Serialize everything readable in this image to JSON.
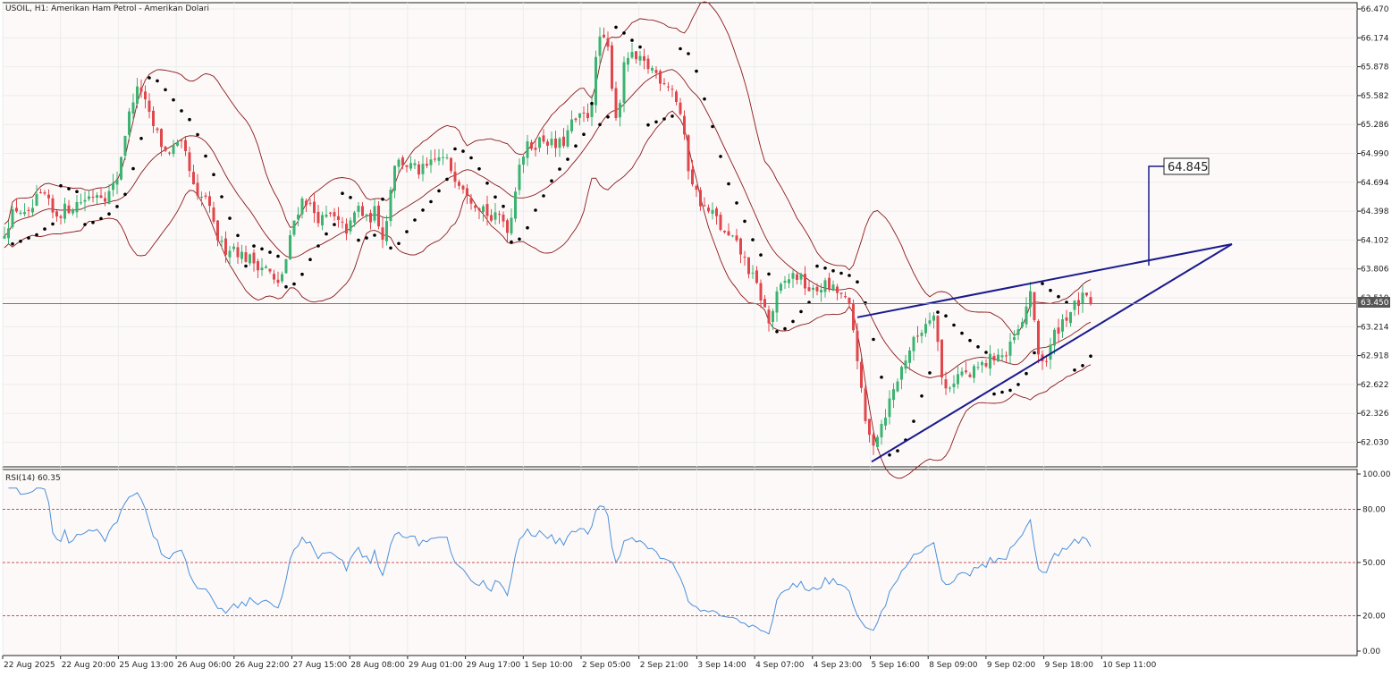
{
  "header": {
    "title": "USOIL, H1:  Amerikan Ham Petrol - Amerikan Dolari"
  },
  "colors": {
    "background": "#fdf9f9",
    "bull": "#3cb371",
    "bear": "#e0474c",
    "bands": "#8b1a1a",
    "sar": "#000000",
    "trendline": "#1a1a8c",
    "rsi_line": "#4a90d9",
    "rsi_level": "#b22222",
    "price_line": "#555555"
  },
  "chart_data": [
    {
      "type": "candlestick",
      "title": "USOIL, H1:  Amerikan Ham Petrol - Amerikan Dolari",
      "indicators": [
        "Bollinger Bands",
        "Parabolic SAR"
      ],
      "ylim": [
        61.78,
        66.49
      ],
      "y_ticks": [
        "66.470",
        "66.174",
        "65.878",
        "65.582",
        "65.286",
        "64.990",
        "64.694",
        "64.398",
        "64.102",
        "63.806",
        "63.510",
        "63.214",
        "62.918",
        "62.622",
        "62.326",
        "62.030"
      ],
      "x_ticks": [
        "22 Aug 2025",
        "22 Aug 20:00",
        "25 Aug 13:00",
        "26 Aug 06:00",
        "26 Aug 22:00",
        "27 Aug 15:00",
        "28 Aug 08:00",
        "29 Aug 01:00",
        "29 Aug 17:00",
        "1 Sep 10:00",
        "2 Sep 05:00",
        "2 Sep 21:00",
        "3 Sep 14:00",
        "4 Sep 07:00",
        "4 Sep 23:00",
        "5 Sep 16:00",
        "8 Sep 09:00",
        "9 Sep 02:00",
        "9 Sep 18:00",
        "10 Sep 11:00"
      ],
      "current_price": "63.450",
      "annotation": "64.845",
      "close_path": [
        [
          0,
          64.1
        ],
        [
          10,
          64.3
        ],
        [
          20,
          64.45
        ],
        [
          30,
          64.3
        ],
        [
          40,
          64.5
        ],
        [
          50,
          64.55
        ],
        [
          60,
          64.35
        ],
        [
          70,
          64.4
        ],
        [
          80,
          64.45
        ],
        [
          90,
          64.5
        ],
        [
          100,
          64.55
        ],
        [
          110,
          64.6
        ],
        [
          120,
          64.55
        ],
        [
          130,
          64.7
        ],
        [
          140,
          65.2
        ],
        [
          150,
          65.6
        ],
        [
          158,
          65.65
        ],
        [
          165,
          65.4
        ],
        [
          175,
          65.2
        ],
        [
          185,
          65.0
        ],
        [
          195,
          65.05
        ],
        [
          205,
          65.05
        ],
        [
          212,
          64.8
        ],
        [
          220,
          64.5
        ],
        [
          230,
          64.55
        ],
        [
          240,
          64.2
        ],
        [
          250,
          64.0
        ],
        [
          260,
          64.05
        ],
        [
          270,
          63.95
        ],
        [
          280,
          63.9
        ],
        [
          290,
          63.85
        ],
        [
          300,
          63.8
        ],
        [
          310,
          63.6
        ],
        [
          320,
          63.9
        ],
        [
          330,
          64.35
        ],
        [
          340,
          64.55
        ],
        [
          350,
          64.4
        ],
        [
          360,
          64.3
        ],
        [
          370,
          64.35
        ],
        [
          380,
          64.25
        ],
        [
          390,
          64.2
        ],
        [
          400,
          64.45
        ],
        [
          410,
          64.3
        ],
        [
          420,
          64.4
        ],
        [
          430,
          64.1
        ],
        [
          440,
          64.9
        ],
        [
          450,
          64.9
        ],
        [
          460,
          64.85
        ],
        [
          470,
          64.8
        ],
        [
          480,
          64.85
        ],
        [
          490,
          64.95
        ],
        [
          500,
          64.9
        ],
        [
          510,
          64.75
        ],
        [
          520,
          64.65
        ],
        [
          530,
          64.5
        ],
        [
          540,
          64.45
        ],
        [
          550,
          64.3
        ],
        [
          560,
          64.35
        ],
        [
          570,
          64.2
        ],
        [
          580,
          64.9
        ],
        [
          590,
          65.05
        ],
        [
          600,
          65.1
        ],
        [
          610,
          65.15
        ],
        [
          620,
          65.05
        ],
        [
          630,
          65.1
        ],
        [
          640,
          65.3
        ],
        [
          650,
          65.35
        ],
        [
          660,
          65.4
        ],
        [
          670,
          66.2
        ],
        [
          680,
          66.05
        ],
        [
          690,
          65.3
        ],
        [
          700,
          66.0
        ],
        [
          710,
          65.95
        ],
        [
          720,
          65.9
        ],
        [
          730,
          65.85
        ],
        [
          740,
          65.75
        ],
        [
          750,
          65.7
        ],
        [
          760,
          65.45
        ],
        [
          770,
          64.85
        ],
        [
          780,
          64.55
        ],
        [
          790,
          64.4
        ],
        [
          800,
          64.35
        ],
        [
          810,
          64.15
        ],
        [
          820,
          64.1
        ],
        [
          830,
          63.95
        ],
        [
          840,
          63.75
        ],
        [
          850,
          63.55
        ],
        [
          860,
          63.25
        ],
        [
          870,
          63.55
        ],
        [
          880,
          63.7
        ],
        [
          890,
          63.75
        ],
        [
          900,
          63.65
        ],
        [
          910,
          63.55
        ],
        [
          920,
          63.65
        ],
        [
          930,
          63.6
        ],
        [
          940,
          63.55
        ],
        [
          950,
          63.4
        ],
        [
          958,
          63.0
        ],
        [
          966,
          62.3
        ],
        [
          975,
          62.0
        ],
        [
          985,
          62.2
        ],
        [
          995,
          62.45
        ],
        [
          1005,
          62.7
        ],
        [
          1015,
          62.95
        ],
        [
          1025,
          63.1
        ],
        [
          1035,
          63.25
        ],
        [
          1045,
          63.4
        ],
        [
          1055,
          62.55
        ],
        [
          1065,
          62.65
        ],
        [
          1075,
          62.75
        ],
        [
          1085,
          62.7
        ],
        [
          1095,
          62.8
        ],
        [
          1105,
          62.85
        ],
        [
          1115,
          62.95
        ],
        [
          1125,
          62.9
        ],
        [
          1135,
          63.1
        ],
        [
          1145,
          63.25
        ],
        [
          1152,
          63.65
        ],
        [
          1160,
          62.95
        ],
        [
          1170,
          62.85
        ],
        [
          1180,
          63.15
        ],
        [
          1190,
          63.3
        ],
        [
          1200,
          63.4
        ],
        [
          1210,
          63.5
        ],
        [
          1220,
          63.45
        ]
      ],
      "trendlines": [
        {
          "name": "upper",
          "from": [
            959,
            63.31
          ],
          "to": [
            1378,
            64.06
          ]
        },
        {
          "name": "lower",
          "from": [
            975,
            61.83
          ],
          "to": [
            1378,
            64.06
          ]
        }
      ]
    },
    {
      "type": "line",
      "title": "RSI(14) 60.35",
      "ylim": [
        0,
        100
      ],
      "y_ticks": [
        "100.00",
        "80.00",
        "50.00",
        "20.00",
        "0.00"
      ],
      "levels": [
        80,
        50,
        20
      ],
      "x_max": 1222
    }
  ]
}
